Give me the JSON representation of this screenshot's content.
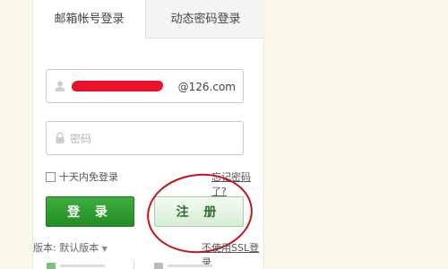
{
  "tabs": [
    {
      "label": "邮箱帐号登录",
      "active": true
    },
    {
      "label": "动态密码登录",
      "active": false
    }
  ],
  "username": {
    "suffix": "@126.com",
    "value_redacted": true
  },
  "password": {
    "placeholder": "密码"
  },
  "remember": {
    "label": "十天内免登录",
    "checked": false
  },
  "forgot": {
    "label": "忘记密码了?"
  },
  "buttons": {
    "login": "登 录",
    "register": "注 册"
  },
  "footer": {
    "version": "版本: 默认版本",
    "ssl": "不使用SSL登录"
  },
  "colors": {
    "login_green": "#2a9a2c",
    "register_bg": "#e4f3e1",
    "annotation_red": "#c41418",
    "page_bg": "#fbf8ea"
  }
}
